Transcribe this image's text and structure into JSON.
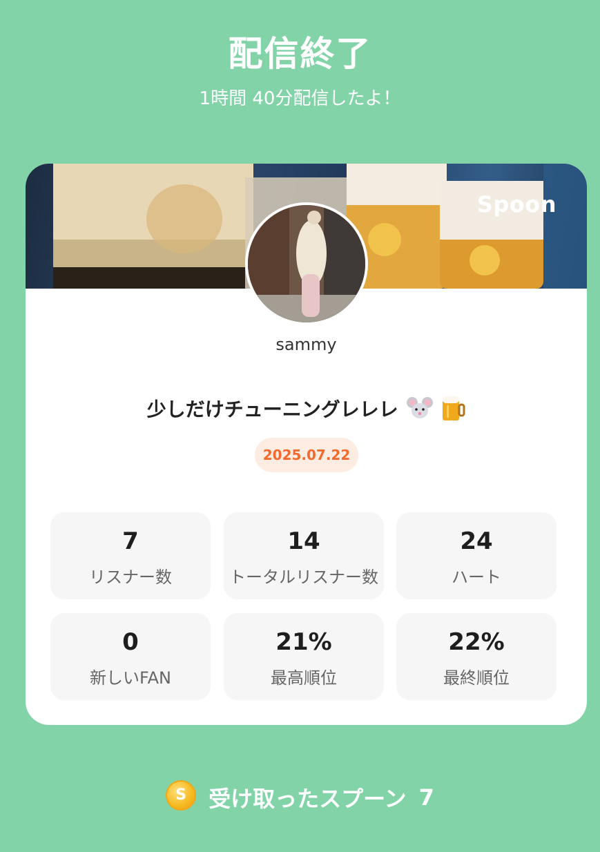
{
  "header": {
    "title": "配信終了",
    "subtitle": "1時間 40分配信したよ！"
  },
  "card": {
    "brand": "Spoon",
    "username": "sammy",
    "stream_title": "少しだけチューニングレレレ",
    "date": "2025.07.22"
  },
  "stats": [
    {
      "value": "7",
      "label": "リスナー数"
    },
    {
      "value": "14",
      "label": "トータルリスナー数"
    },
    {
      "value": "24",
      "label": "ハート"
    },
    {
      "value": "0",
      "label": "新しいFAN"
    },
    {
      "value": "21%",
      "label": "最高順位"
    },
    {
      "value": "22%",
      "label": "最終順位"
    }
  ],
  "footer": {
    "coin_symbol": "S",
    "label": "受け取ったスプーン",
    "count": "7"
  },
  "colors": {
    "background": "#82d4a8",
    "card": "#ffffff",
    "date_pill_bg": "#fdece2",
    "date_pill_text": "#f26a2e",
    "stat_bg": "#f6f6f6"
  }
}
